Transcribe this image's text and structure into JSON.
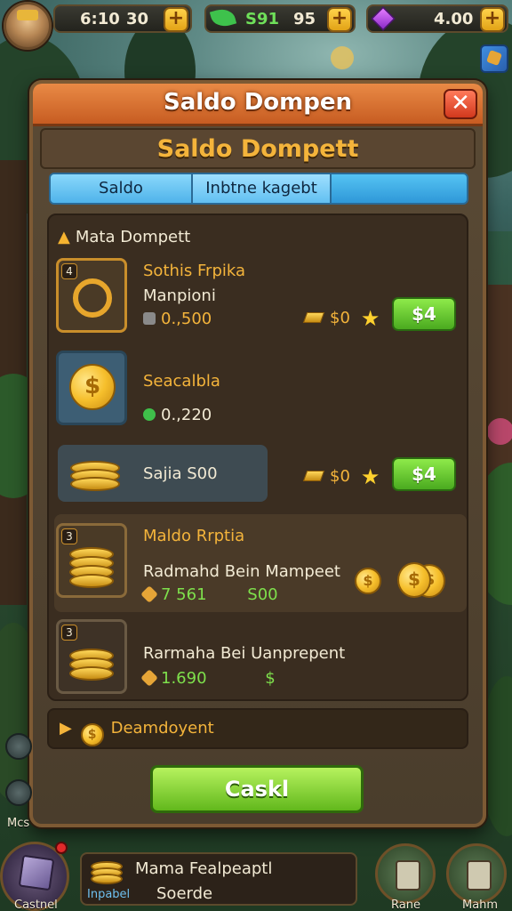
{
  "top_bar": {
    "resource1": {
      "value": "6:10",
      "value2": "30"
    },
    "resource2": {
      "value": "S91",
      "value2": "95"
    },
    "resource3": {
      "value": "4.00"
    },
    "plus_label": "+"
  },
  "dialog": {
    "title": "Saldo Dompen",
    "close_label": "✕",
    "subtitle": "Saldo Dompett",
    "tabs": [
      {
        "label": "Saldo"
      },
      {
        "label": "Inbtne kagebt"
      },
      {
        "label": ""
      }
    ],
    "section_label": "Mata Dompett",
    "items": [
      {
        "badge": "4",
        "title": "Sothis Frpika",
        "subtitle": "Manpioni",
        "value": "0.,500",
        "price": "$0",
        "buy_label": "$4"
      },
      {
        "title": "Seacalbla",
        "value": "0.,220"
      },
      {
        "subtitle": "Sajia S00",
        "price": "$0",
        "buy_label": "$4"
      },
      {
        "badge": "3",
        "title": "Maldo Rrptia",
        "subtitle": "Radmahd Bein Mampeet",
        "value": "7 561",
        "value_extra": "S00"
      },
      {
        "badge": "3",
        "subtitle": "Rarmaha Bei Uanprepent",
        "value": "1.690",
        "value_extra": "$"
      }
    ],
    "divider_label": "Deamdoyent",
    "primary_button": "Caskl"
  },
  "bottom_bar": {
    "left_label": "Castnel",
    "side_label": "Mcs",
    "info_title": "Mama Fealpeaptl",
    "info_small": "Inpabel",
    "info_value": "Soerde",
    "btn1_label": "Rane",
    "btn2_label": "Mahm"
  },
  "colors": {
    "accent_gold": "#f4b43b",
    "buy_green": "#62b81c",
    "header_orange": "#c75c22",
    "tab_blue": "#2f98d8"
  }
}
